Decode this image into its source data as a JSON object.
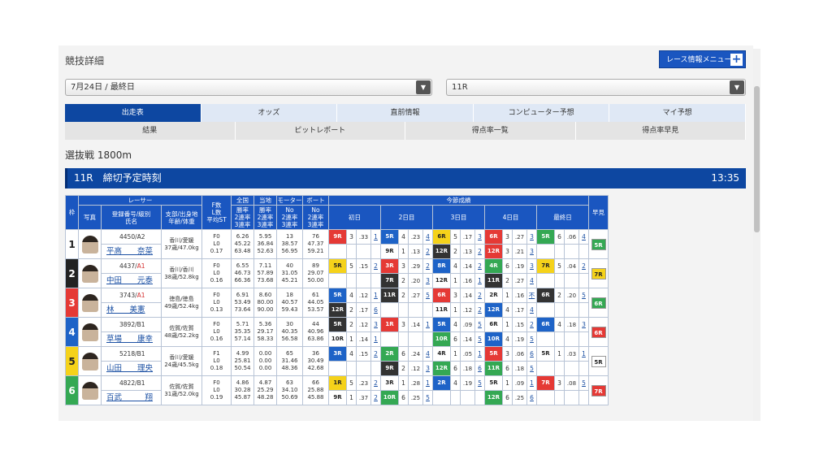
{
  "title": "競技詳細",
  "menu_button": "レース情報メニュー",
  "date_select": "7月24日 / 最終日",
  "race_select": "11R",
  "tabs_row1": [
    "出走表",
    "オッズ",
    "直前情報",
    "コンピューター予想",
    "マイ予想"
  ],
  "tabs_row2": [
    "結果",
    "ピットレポート",
    "得点率一覧",
    "得点率早見"
  ],
  "race_type": "選抜戦 1800m",
  "race_heading": "11R　締切予定時刻",
  "race_time": "13:35",
  "headers": {
    "waku": "枠",
    "racer": "レーサー",
    "photo": "写真",
    "id_class_name": "登録番号/級別\n氏名",
    "branch": "支部/出身地\n年齢/体重",
    "fst": "F数\nL数\n平均ST",
    "all": "全国",
    "local": "当地",
    "motor": "モーター",
    "boat": "ボート",
    "all_sub": "勝率\n2連率\n3連率",
    "local_sub": "勝率\n2連率\n3連率",
    "motor_sub": "No\n2連率\n3連率",
    "boat_sub": "No\n2連率\n3連率",
    "series": "今節成績",
    "days": [
      "初日",
      "2日目",
      "3日目",
      "4日目",
      "最終日"
    ],
    "hayami": "早見"
  },
  "lane_colors": [
    "#ffffff",
    "#222222",
    "#e53935",
    "#1e63c7",
    "#f5d21a",
    "#34a853"
  ],
  "lane_text": [
    "#222",
    "#fff",
    "#fff",
    "#fff",
    "#222",
    "#fff"
  ],
  "racers": [
    {
      "lane": "1",
      "id": "4450/A2",
      "cls_red": false,
      "name": "平高　　奈菜",
      "branch": "香川/愛媛",
      "age": "37歳/47.0kg",
      "f": "F0",
      "l": "L0",
      "st": "0.17",
      "all": [
        "6.26",
        "45.22",
        "63.48"
      ],
      "local": [
        "5.95",
        "36.84",
        "52.63"
      ],
      "motor": [
        "13",
        "38.57",
        "56.95"
      ],
      "boat": [
        "76",
        "47.37",
        "59.21"
      ],
      "r1": [
        [
          "9R",
          "3",
          ".33",
          "1"
        ],
        [
          "5R",
          "4",
          ".23",
          "4"
        ],
        [
          "6R",
          "5",
          ".17",
          "3"
        ],
        [
          "6R",
          "3",
          ".27",
          "3"
        ],
        [
          "5R",
          "6",
          ".06",
          "4"
        ]
      ],
      "r2": [
        [
          "",
          "",
          "",
          ""
        ],
        [
          "9R",
          "1",
          ".13",
          "2"
        ],
        [
          "12R",
          "2",
          ".13",
          "2"
        ],
        [
          "12R",
          "3",
          ".21",
          "3"
        ],
        [
          "",
          "",
          "",
          ""
        ]
      ],
      "hayami": "5R"
    },
    {
      "lane": "2",
      "id": "4437/A1",
      "cls_red": true,
      "name": "中田　　元泰",
      "branch": "香川/香川",
      "age": "38歳/52.8kg",
      "f": "F0",
      "l": "L0",
      "st": "0.16",
      "all": [
        "6.55",
        "46.73",
        "66.36"
      ],
      "local": [
        "7.11",
        "57.89",
        "73.68"
      ],
      "motor": [
        "40",
        "31.05",
        "45.21"
      ],
      "boat": [
        "89",
        "29.07",
        "50.00"
      ],
      "r1": [
        [
          "5R",
          "5",
          ".15",
          "2"
        ],
        [
          "3R",
          "3",
          ".29",
          "2"
        ],
        [
          "8R",
          "4",
          ".14",
          "2"
        ],
        [
          "4R",
          "6",
          ".19",
          "3"
        ],
        [
          "7R",
          "5",
          ".04",
          "2"
        ]
      ],
      "r2": [
        [
          "",
          "",
          "",
          ""
        ],
        [
          "7R",
          "2",
          ".20",
          "3"
        ],
        [
          "12R",
          "1",
          ".16",
          "1"
        ],
        [
          "11R",
          "2",
          ".27",
          "4"
        ],
        [
          "",
          "",
          "",
          ""
        ]
      ],
      "hayami": "7R"
    },
    {
      "lane": "3",
      "id": "3743/A1",
      "cls_red": true,
      "name": "林　　美憲",
      "branch": "徳島/徳島",
      "age": "49歳/52.4kg",
      "f": "F0",
      "l": "L0",
      "st": "0.13",
      "all": [
        "6.91",
        "53.49",
        "73.64"
      ],
      "local": [
        "8.60",
        "80.00",
        "90.00"
      ],
      "motor": [
        "18",
        "40.57",
        "59.43"
      ],
      "boat": [
        "61",
        "44.05",
        "53.57"
      ],
      "r1": [
        [
          "5R",
          "4",
          ".12",
          "1"
        ],
        [
          "11R",
          "2",
          ".27",
          "5"
        ],
        [
          "6R",
          "3",
          ".14",
          "2"
        ],
        [
          "2R",
          "1",
          ".16",
          "不"
        ],
        [
          "6R",
          "2",
          ".20",
          "5"
        ]
      ],
      "r2": [
        [
          "12R",
          "2",
          ".17",
          "6"
        ],
        [
          "",
          "",
          "",
          ""
        ],
        [
          "11R",
          "1",
          ".12",
          "2"
        ],
        [
          "12R",
          "4",
          ".17",
          "4"
        ],
        [
          "",
          "",
          "",
          ""
        ]
      ],
      "hayami": "6R"
    },
    {
      "lane": "4",
      "id": "3892/B1",
      "cls_red": false,
      "name": "草場　　康幸",
      "branch": "佐賀/佐賀",
      "age": "48歳/52.2kg",
      "f": "F0",
      "l": "L0",
      "st": "0.16",
      "all": [
        "5.71",
        "35.35",
        "57.14"
      ],
      "local": [
        "5.36",
        "29.17",
        "58.33"
      ],
      "motor": [
        "30",
        "40.35",
        "56.58"
      ],
      "boat": [
        "44",
        "40.96",
        "63.86"
      ],
      "r1": [
        [
          "5R",
          "2",
          ".12",
          "3"
        ],
        [
          "1R",
          "3",
          ".14",
          "1"
        ],
        [
          "5R",
          "4",
          ".09",
          "5"
        ],
        [
          "6R",
          "1",
          ".15",
          "2"
        ],
        [
          "6R",
          "4",
          ".18",
          "3"
        ]
      ],
      "r2": [
        [
          "10R",
          "1",
          ".14",
          "1"
        ],
        [
          "",
          "",
          "",
          ""
        ],
        [
          "10R",
          "6",
          ".14",
          "5"
        ],
        [
          "10R",
          "4",
          ".19",
          "5"
        ],
        [
          "",
          "",
          "",
          ""
        ]
      ],
      "hayami": "6R"
    },
    {
      "lane": "5",
      "id": "5218/B1",
      "cls_red": false,
      "name": "山田　　理央",
      "branch": "香川/愛媛",
      "age": "24歳/45.5kg",
      "f": "F1",
      "l": "L0",
      "st": "0.18",
      "all": [
        "4.99",
        "25.81",
        "50.54"
      ],
      "local": [
        "0.00",
        "0.00",
        "0.00"
      ],
      "motor": [
        "65",
        "31.46",
        "48.36"
      ],
      "boat": [
        "36",
        "30.49",
        "42.68"
      ],
      "r1": [
        [
          "3R",
          "4",
          ".15",
          "2"
        ],
        [
          "2R",
          "6",
          ".24",
          "4"
        ],
        [
          "4R",
          "1",
          ".05",
          "1"
        ],
        [
          "5R",
          "3",
          ".06",
          "6"
        ],
        [
          "5R",
          "1",
          ".03",
          "1"
        ]
      ],
      "r2": [
        [
          "",
          "",
          "",
          ""
        ],
        [
          "9R",
          "2",
          ".12",
          "3"
        ],
        [
          "12R",
          "6",
          ".18",
          "6"
        ],
        [
          "11R",
          "6",
          ".18",
          "5"
        ],
        [
          "",
          "",
          "",
          ""
        ]
      ],
      "hayami": "5R"
    },
    {
      "lane": "6",
      "id": "4822/B1",
      "cls_red": false,
      "name": "百武　　　翔",
      "branch": "佐賀/佐賀",
      "age": "31歳/52.0kg",
      "f": "F0",
      "l": "L0",
      "st": "0.19",
      "all": [
        "4.86",
        "30.28",
        "45.87"
      ],
      "local": [
        "4.87",
        "25.29",
        "48.28"
      ],
      "motor": [
        "63",
        "34.10",
        "50.69"
      ],
      "boat": [
        "66",
        "25.88",
        "45.88"
      ],
      "r1": [
        [
          "1R",
          "5",
          ".23",
          "2"
        ],
        [
          "3R",
          "1",
          ".28",
          "1"
        ],
        [
          "2R",
          "4",
          ".19",
          "5"
        ],
        [
          "5R",
          "1",
          ".09",
          "1"
        ],
        [
          "7R",
          "3",
          ".08",
          "5"
        ]
      ],
      "r2": [
        [
          "9R",
          "1",
          ".37",
          "2"
        ],
        [
          "10R",
          "6",
          ".25",
          "5"
        ],
        [
          "",
          "",
          "",
          ""
        ],
        [
          "12R",
          "6",
          ".25",
          "6"
        ],
        [
          "",
          "",
          "",
          ""
        ]
      ],
      "hayami": "7R"
    }
  ],
  "course_colors": {
    "1": "#ffffff",
    "2": "#333333",
    "3": "#e53935",
    "4": "#1e63c7",
    "5": "#f5d21a",
    "6": "#34a853"
  }
}
